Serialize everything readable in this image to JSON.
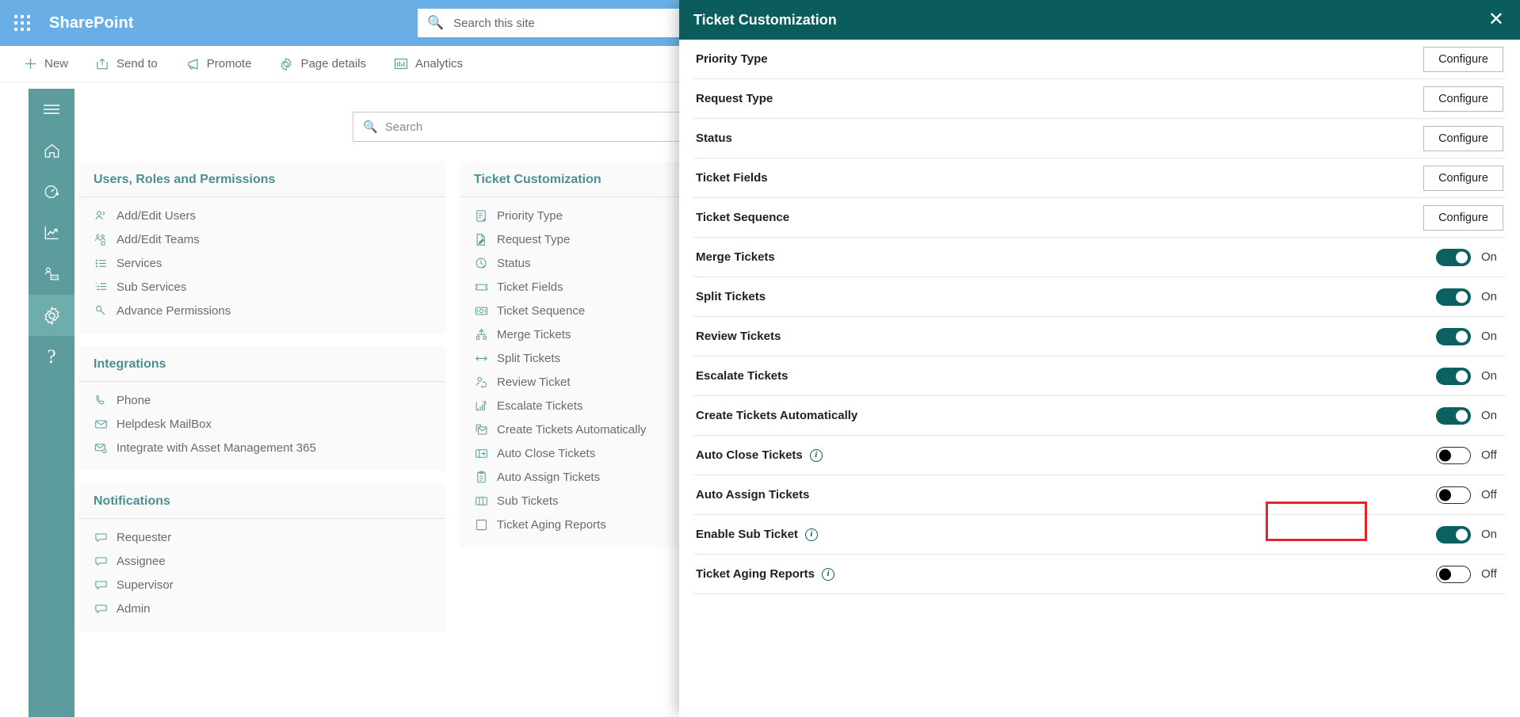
{
  "suite": {
    "brand": "SharePoint",
    "waffle_icon": "app-launcher-icon",
    "search_placeholder": "Search this site",
    "search_icon": "search-icon"
  },
  "command_bar": {
    "items": [
      {
        "label": "New",
        "icon": "plus-icon"
      },
      {
        "label": "Send to",
        "icon": "send-to-icon"
      },
      {
        "label": "Promote",
        "icon": "megaphone-icon"
      },
      {
        "label": "Page details",
        "icon": "gear-icon"
      },
      {
        "label": "Analytics",
        "icon": "analytics-icon"
      }
    ]
  },
  "rail": {
    "items": [
      {
        "name": "menu",
        "icon": "hamburger-icon",
        "active": false
      },
      {
        "name": "home",
        "icon": "home-icon",
        "active": false
      },
      {
        "name": "dashboard",
        "icon": "gauge-icon",
        "active": false
      },
      {
        "name": "reports",
        "icon": "chart-line-icon",
        "active": false
      },
      {
        "name": "teams",
        "icon": "org-people-icon",
        "active": false
      },
      {
        "name": "settings",
        "icon": "gear-icon",
        "active": true
      },
      {
        "name": "help",
        "icon": "question-icon",
        "active": false
      }
    ]
  },
  "page_search": {
    "placeholder": "Search",
    "icon": "search-icon"
  },
  "cards": [
    {
      "title": "Users, Roles and Permissions",
      "links": [
        {
          "label": "Add/Edit Users",
          "icon": "users-icon"
        },
        {
          "label": "Add/Edit Teams",
          "icon": "teams-icon"
        },
        {
          "label": "Services",
          "icon": "list-icon"
        },
        {
          "label": "Sub Services",
          "icon": "sub-list-icon"
        },
        {
          "label": "Advance Permissions",
          "icon": "key-icon"
        }
      ]
    },
    {
      "title": "Integrations",
      "links": [
        {
          "label": "Phone",
          "icon": "phone-icon"
        },
        {
          "label": "Helpdesk MailBox",
          "icon": "mail-icon"
        },
        {
          "label": "Integrate with Asset Management 365",
          "icon": "mail-gear-icon"
        }
      ]
    },
    {
      "title": "Notifications",
      "links": [
        {
          "label": "Requester",
          "icon": "comment-icon"
        },
        {
          "label": "Assignee",
          "icon": "comment-icon"
        },
        {
          "label": "Supervisor",
          "icon": "comment-icon"
        },
        {
          "label": "Admin",
          "icon": "comment-icon"
        }
      ]
    },
    {
      "title": "Ticket Customization",
      "links": [
        {
          "label": "Priority Type",
          "icon": "priority-list-icon"
        },
        {
          "label": "Request Type",
          "icon": "request-edit-icon"
        },
        {
          "label": "Status",
          "icon": "clock-check-icon"
        },
        {
          "label": "Ticket Fields",
          "icon": "ticket-icon"
        },
        {
          "label": "Ticket Sequence",
          "icon": "sequence-icon"
        },
        {
          "label": "Merge Tickets",
          "icon": "merge-icon"
        },
        {
          "label": "Split Tickets",
          "icon": "split-icon"
        },
        {
          "label": "Review Ticket",
          "icon": "review-person-icon"
        },
        {
          "label": "Escalate Tickets",
          "icon": "escalate-chart-icon"
        },
        {
          "label": "Create Tickets Automatically",
          "icon": "create-auto-icon"
        },
        {
          "label": "Auto Close Tickets",
          "icon": "auto-close-icon"
        },
        {
          "label": "Auto Assign Tickets",
          "icon": "auto-assign-icon"
        },
        {
          "label": "Sub Tickets",
          "icon": "sub-tickets-icon"
        },
        {
          "label": "Ticket Aging Reports",
          "icon": "aging-report-icon"
        }
      ]
    }
  ],
  "panel": {
    "title": "Ticket Customization",
    "close_icon": "close-icon",
    "configure_label": "Configure",
    "rows": [
      {
        "label": "Priority Type",
        "control": "button",
        "info": false
      },
      {
        "label": "Request Type",
        "control": "button",
        "info": false
      },
      {
        "label": "Status",
        "control": "button",
        "info": false
      },
      {
        "label": "Ticket Fields",
        "control": "button",
        "info": false
      },
      {
        "label": "Ticket Sequence",
        "control": "button",
        "info": false
      },
      {
        "label": "Merge Tickets",
        "control": "toggle",
        "state": "On",
        "info": false,
        "highlight": false
      },
      {
        "label": "Split Tickets",
        "control": "toggle",
        "state": "On",
        "info": false,
        "highlight": false
      },
      {
        "label": "Review Tickets",
        "control": "toggle",
        "state": "On",
        "info": false,
        "highlight": false
      },
      {
        "label": "Escalate Tickets",
        "control": "toggle",
        "state": "On",
        "info": false,
        "highlight": false
      },
      {
        "label": "Create Tickets Automatically",
        "control": "toggle",
        "state": "On",
        "info": false,
        "highlight": false
      },
      {
        "label": "Auto Close Tickets",
        "control": "toggle",
        "state": "Off",
        "info": true,
        "highlight": false
      },
      {
        "label": "Auto Assign Tickets",
        "control": "toggle",
        "state": "Off",
        "info": false,
        "highlight": false
      },
      {
        "label": "Enable Sub Ticket",
        "control": "toggle",
        "state": "On",
        "info": true,
        "highlight": true
      },
      {
        "label": "Ticket Aging Reports",
        "control": "toggle",
        "state": "Off",
        "info": true,
        "highlight": false
      }
    ]
  },
  "colors": {
    "suite_bar": "#69afe5",
    "rail": "#5d9c9c",
    "rail_active": "#6fadad",
    "panel_header": "#0b5c5c",
    "toggle_on": "#0b6060",
    "card_title": "#4c8f93",
    "highlight": "#e8232a"
  }
}
